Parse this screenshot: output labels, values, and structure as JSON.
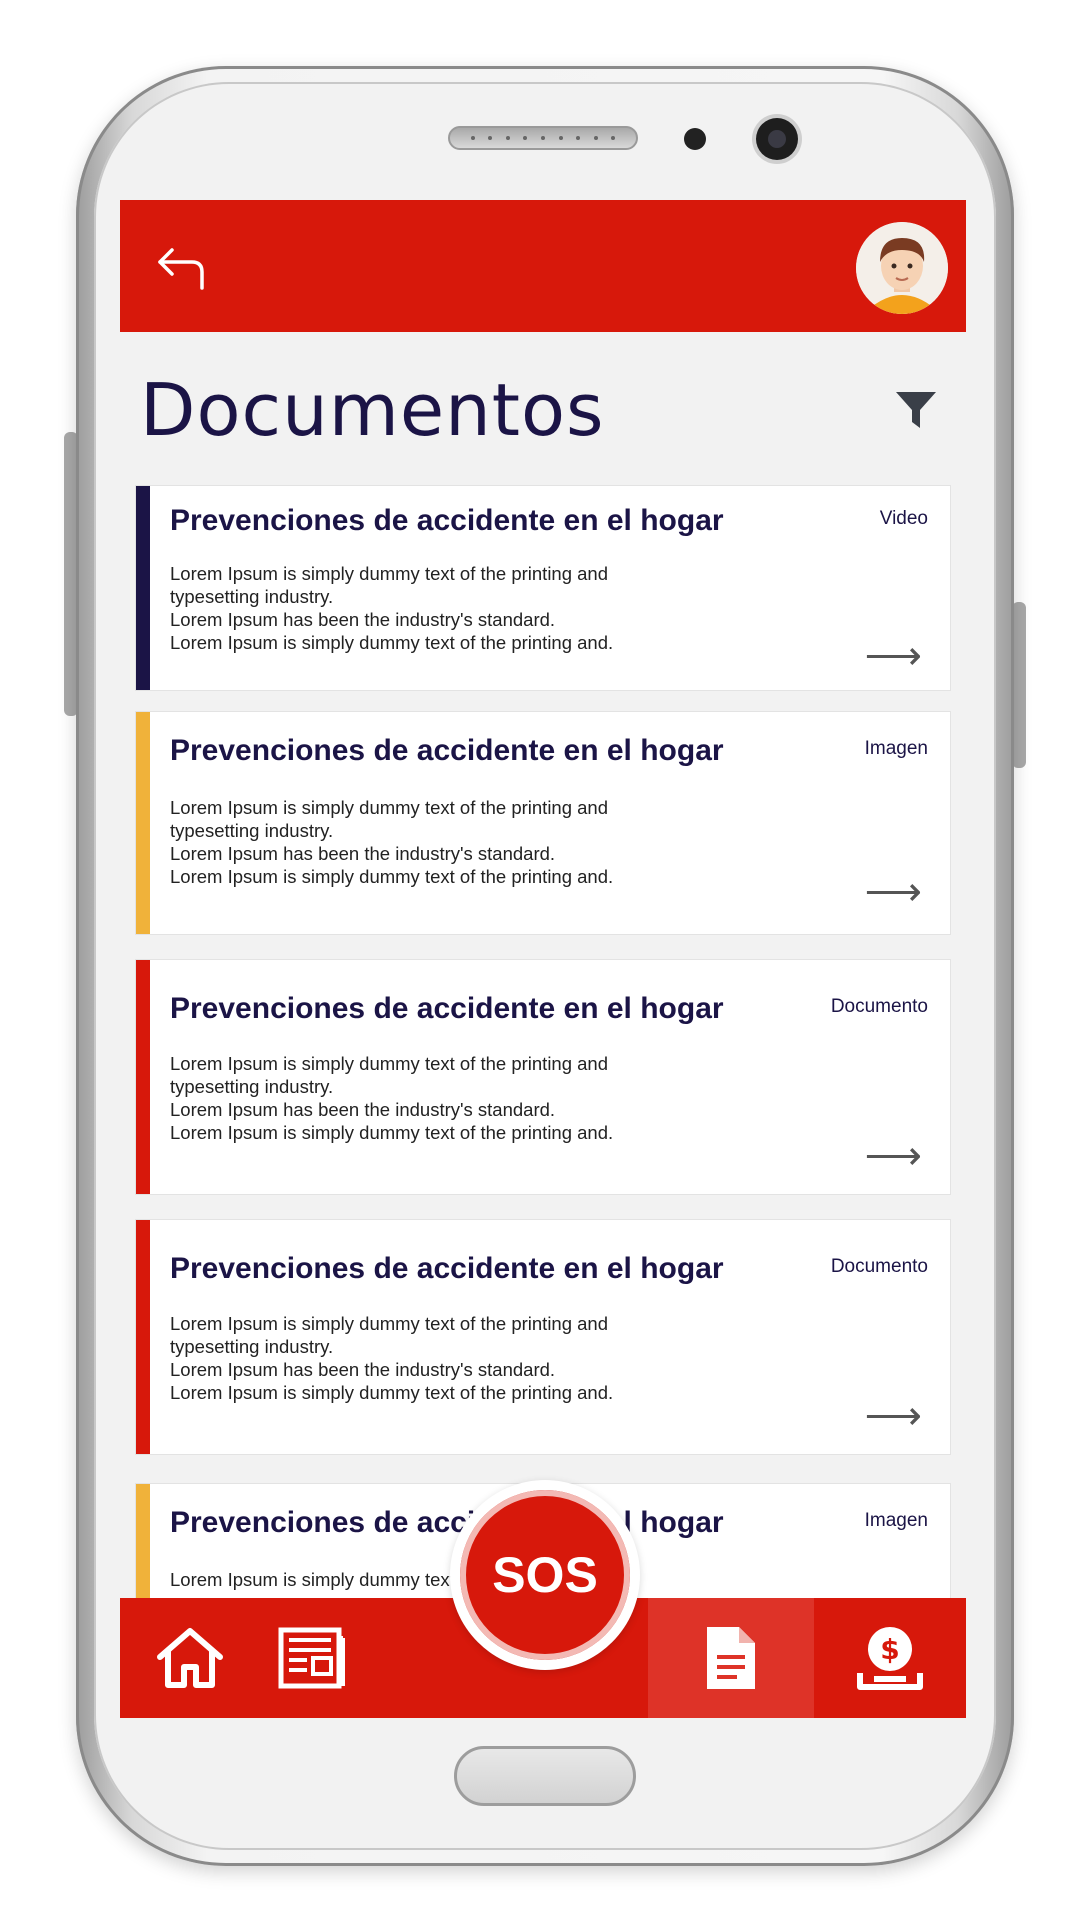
{
  "header": {
    "back_icon": "back-arrow-icon",
    "avatar_icon": "user-avatar"
  },
  "page": {
    "title": "Documentos",
    "filter_icon": "filter-icon"
  },
  "documents": [
    {
      "title": "Prevenciones de accidente en el hogar",
      "type": "Video",
      "accent": "#1b1446",
      "lines": [
        "Lorem Ipsum is simply dummy text of the printing and",
        "typesetting industry.",
        "Lorem Ipsum has been the industry's standard.",
        "Lorem Ipsum is simply dummy text of the printing and."
      ]
    },
    {
      "title": "Prevenciones de accidente en el hogar",
      "type": "Imagen",
      "accent": "#f0b23a",
      "lines": [
        "Lorem Ipsum is simply dummy text of the printing and",
        "typesetting industry.",
        "Lorem Ipsum has been the industry's standard.",
        "Lorem Ipsum is simply dummy text of the printing and."
      ]
    },
    {
      "title": "Prevenciones de accidente en el hogar",
      "type": "Documento",
      "accent": "#d7180b",
      "lines": [
        "Lorem Ipsum is simply dummy text of the printing and",
        "typesetting industry.",
        "Lorem Ipsum has been the industry's standard.",
        "Lorem Ipsum is simply dummy text of the printing and."
      ]
    },
    {
      "title": "Prevenciones de accidente en el hogar",
      "type": "Documento",
      "accent": "#d7180b",
      "lines": [
        "Lorem Ipsum is simply dummy text of the printing and",
        "typesetting industry.",
        "Lorem Ipsum has been the industry's standard.",
        "Lorem Ipsum is simply dummy text of the printing and."
      ]
    },
    {
      "title": "Prevenciones de accidente en el hogar",
      "type": "Imagen",
      "accent": "#f0b23a",
      "lines": [
        "Lorem Ipsum is simply dummy text of the printing and"
      ]
    }
  ],
  "bottom_nav": {
    "sos_label": "SOS",
    "items": [
      "home-icon",
      "newspaper-icon",
      "document-icon",
      "money-icon"
    ],
    "active": "document-icon"
  },
  "colors": {
    "primary": "#d7180b",
    "navy": "#1b1446",
    "yellow": "#f0b23a"
  }
}
